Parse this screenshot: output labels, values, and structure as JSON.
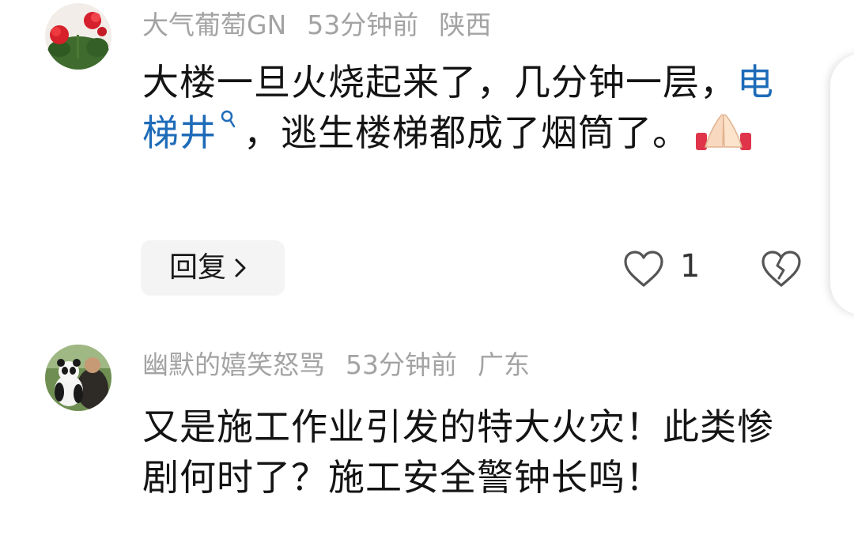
{
  "comments": [
    {
      "username": "大气葡萄GN",
      "time": "53分钟前",
      "location": "陕西",
      "text_part1": "大楼一旦火烧起来了，几分钟一层，",
      "link_text": "电梯井",
      "text_part2": "，逃生楼梯都成了烟筒了。",
      "emoji": "folded-hands",
      "reply_label": "回复",
      "like_count": "1"
    },
    {
      "username": "幽默的嬉笑怒骂",
      "time": "53分钟前",
      "location": "广东",
      "text": "又是施工作业引发的特大火灾！此类惨剧何时了？施工安全警钟长鸣！"
    }
  ],
  "colors": {
    "meta_text": "#a3a3a3",
    "body_text": "#141414",
    "link": "#1e6bb8",
    "reply_bg": "#f4f4f4"
  },
  "icons": {
    "like": "heart-outline-icon",
    "dislike": "broken-heart-icon",
    "reply_chevron": "chevron-right-icon",
    "link_search": "search-icon"
  }
}
